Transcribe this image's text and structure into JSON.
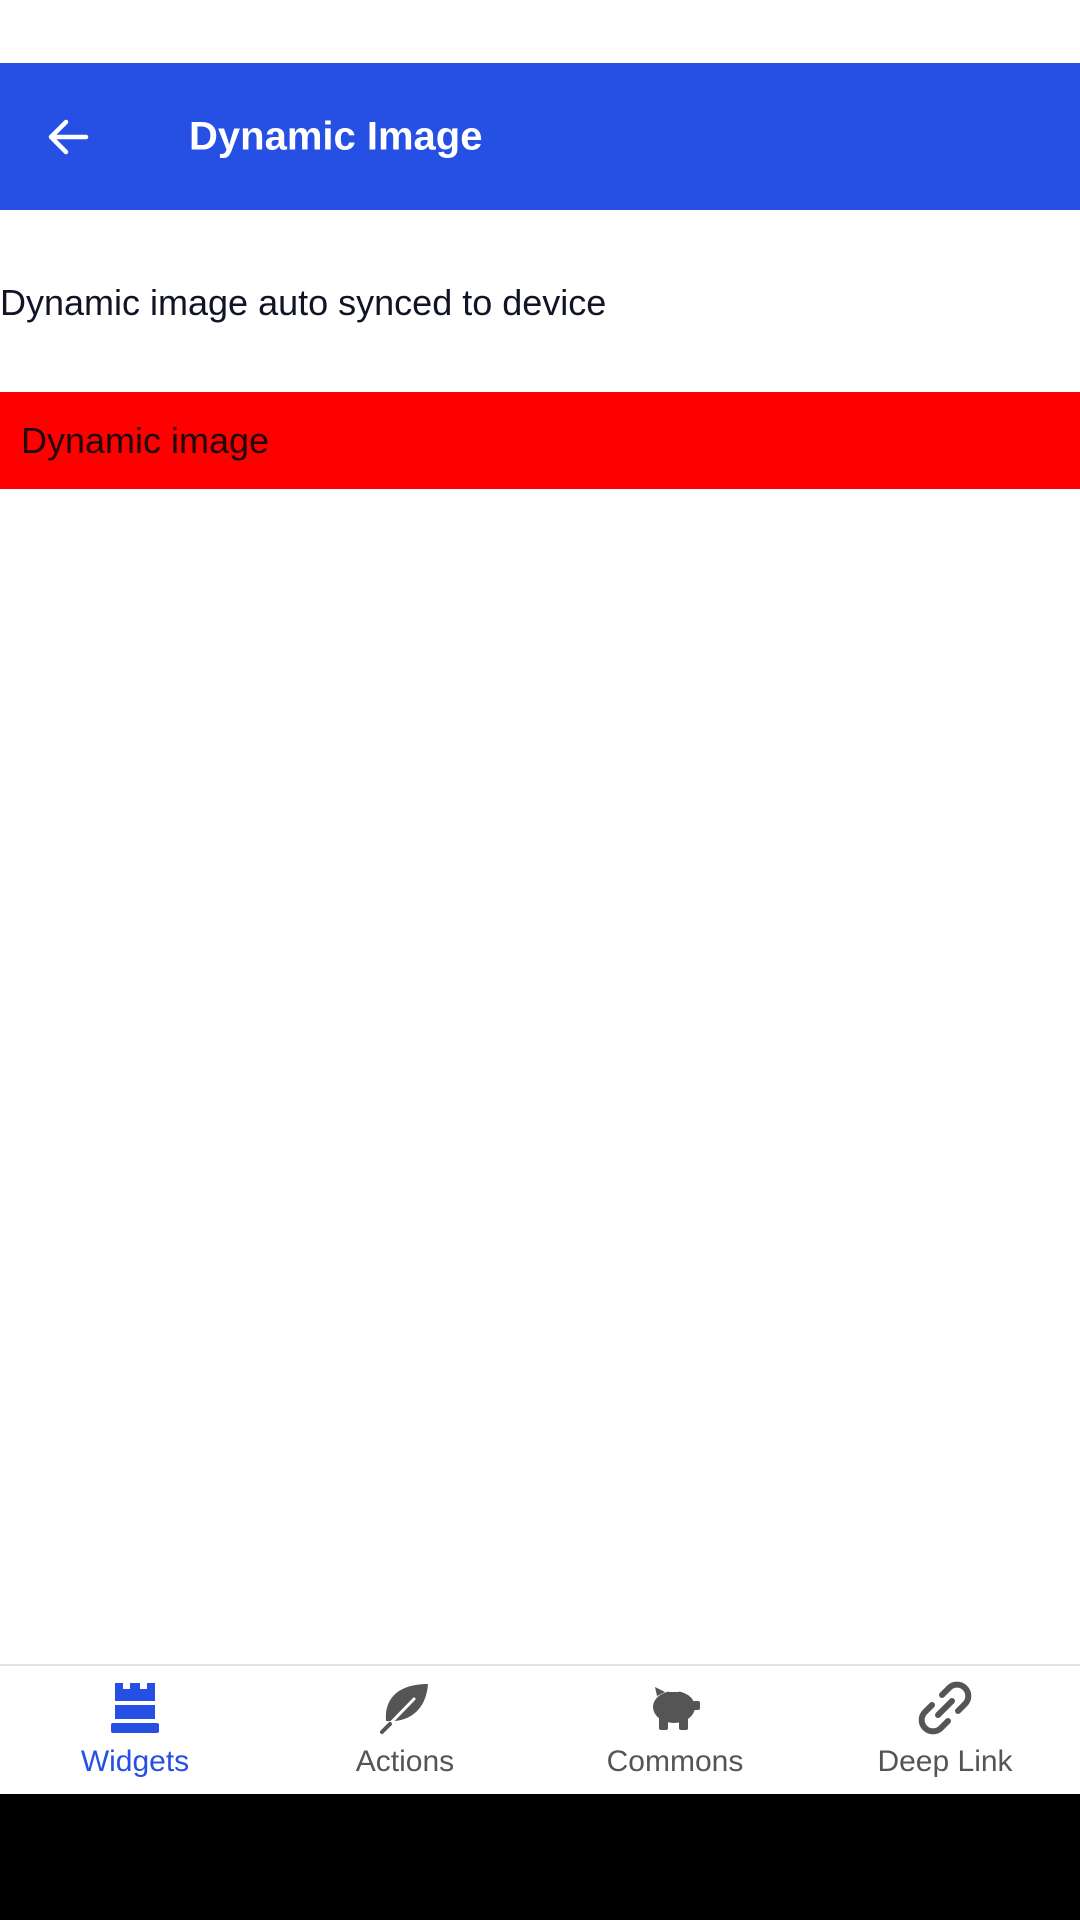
{
  "colors": {
    "primary": "#2650E4",
    "banner": "#FF0000",
    "nav_active": "#2650E4",
    "nav_inactive": "#555555",
    "system_nav": "#000000"
  },
  "app_bar": {
    "title": "Dynamic Image",
    "back_icon": "arrow-left-icon"
  },
  "main": {
    "description": "Dynamic image auto synced to device",
    "dynamic_image_label": "Dynamic image"
  },
  "bottom_nav": {
    "items": [
      {
        "label": "Widgets",
        "icon": "rook-icon",
        "active": true
      },
      {
        "label": "Actions",
        "icon": "leaf-icon",
        "active": false
      },
      {
        "label": "Commons",
        "icon": "piggy-bank-icon",
        "active": false
      },
      {
        "label": "Deep Link",
        "icon": "link-icon",
        "active": false
      }
    ]
  }
}
